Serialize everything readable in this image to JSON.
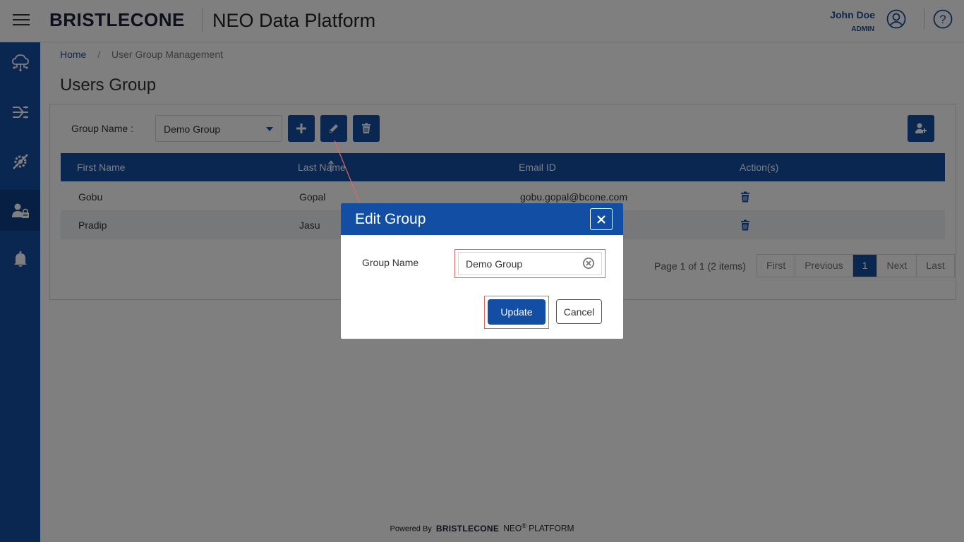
{
  "header": {
    "brand": "BRISTLECONE",
    "app_title": "NEO Data Platform",
    "user_name": "John Doe",
    "user_role": "ADMIN"
  },
  "sidebar": {
    "items": [
      {
        "icon": "cloud-network-icon",
        "active": false
      },
      {
        "icon": "data-flow-icon",
        "active": false
      },
      {
        "icon": "settings-tools-icon",
        "active": false
      },
      {
        "icon": "user-lock-icon",
        "active": true
      },
      {
        "icon": "bell-icon",
        "active": false
      }
    ]
  },
  "breadcrumb": {
    "home": "Home",
    "separator": "/",
    "current": "User Group Management"
  },
  "page_title": "Users Group",
  "toolbar": {
    "group_label": "Group Name :",
    "group_selected": "Demo Group",
    "add_icon": "plus-icon",
    "edit_icon": "pencil-icon",
    "delete_icon": "trash-icon",
    "add_user_icon": "user-plus-icon"
  },
  "table": {
    "headers": [
      "First Name",
      "Last Name",
      "Email ID",
      "Action(s)"
    ],
    "rows": [
      {
        "first": "Gobu",
        "last": "Gopal",
        "email": "gobu.gopal@bcone.com"
      },
      {
        "first": "Pradip",
        "last": "Jasu",
        "email": ""
      }
    ]
  },
  "pager": {
    "info": "Page 1 of 1 (2 items)",
    "first": "First",
    "previous": "Previous",
    "current": "1",
    "next": "Next",
    "last": "Last"
  },
  "footer": {
    "powered_by": "Powered By",
    "brand": "BRISTLECONE",
    "neo": "NEO",
    "reg": "®",
    "platform": "PLATFORM"
  },
  "modal": {
    "title": "Edit Group",
    "field_label": "Group Name",
    "field_value": "Demo Group",
    "update_label": "Update",
    "cancel_label": "Cancel"
  },
  "colors": {
    "primary": "#124ea3",
    "annotation": "#e06666"
  }
}
